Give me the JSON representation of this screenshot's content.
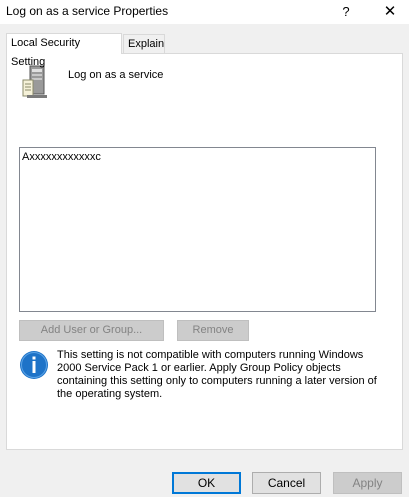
{
  "window": {
    "title": "Log on as a service Properties",
    "help_glyph": "?",
    "close_glyph": "✕"
  },
  "tabs": [
    {
      "label": "Local Security Setting",
      "active": true
    },
    {
      "label": "Explain",
      "active": false
    }
  ],
  "policy": {
    "name": "Log on as a service",
    "icon": "server-policy-icon"
  },
  "accounts": [
    "Axxxxxxxxxxxxc"
  ],
  "actions": {
    "add_label": "Add User or Group...",
    "remove_label": "Remove"
  },
  "info": {
    "icon": "info-icon",
    "text": "This setting is not compatible with computers running Windows 2000 Service Pack 1 or earlier.  Apply Group Policy objects containing this setting only to computers running a later version of the operating system."
  },
  "footer": {
    "ok_label": "OK",
    "cancel_label": "Cancel",
    "apply_label": "Apply"
  },
  "colors": {
    "info_blue": "#1e73c8",
    "default_button_border": "#0078d7"
  }
}
